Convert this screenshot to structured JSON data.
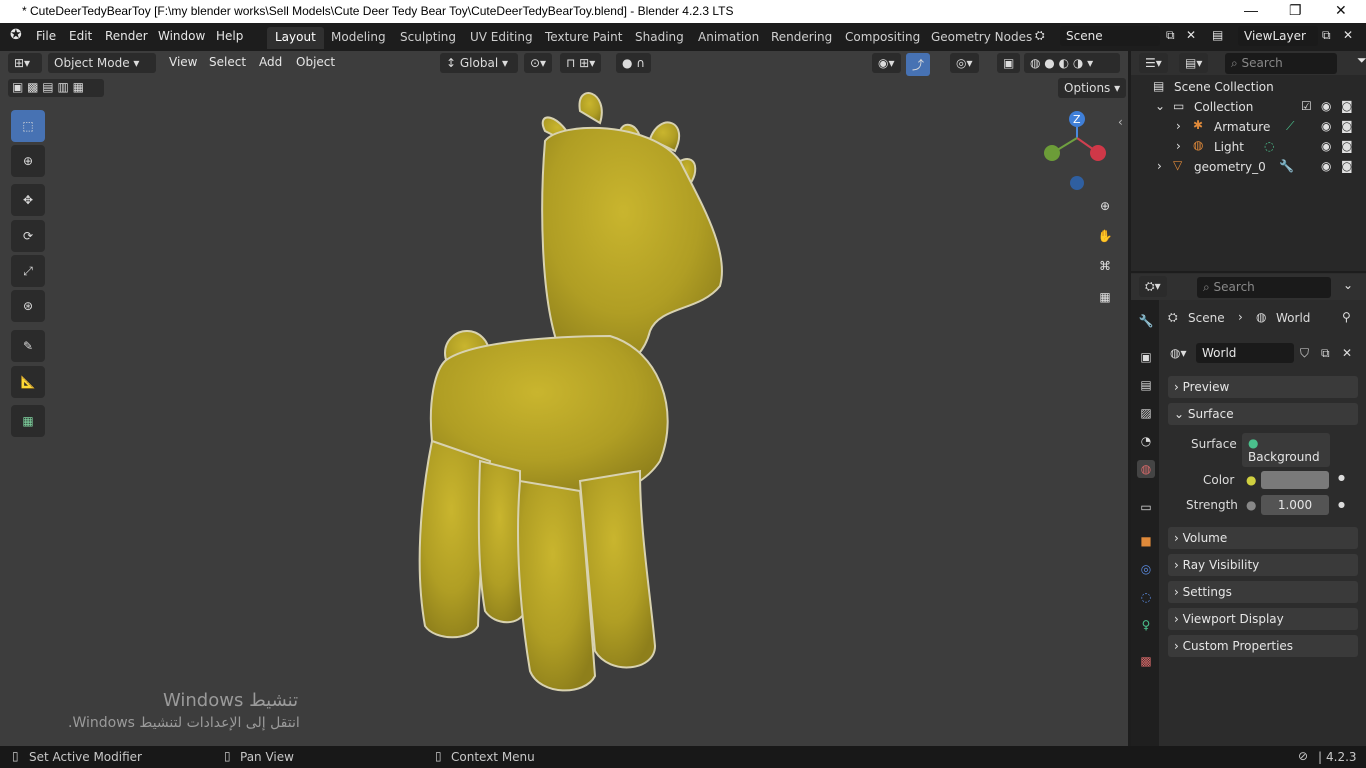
{
  "window": {
    "title": "* CuteDeerTedyBearToy [F:\\my blender works\\Sell Models\\Cute Deer Tedy Bear Toy\\CuteDeerTedyBearToy.blend] - Blender 4.2.3 LTS"
  },
  "menu": [
    "File",
    "Edit",
    "Render",
    "Window",
    "Help"
  ],
  "workspaces": [
    "Layout",
    "Modeling",
    "Sculpting",
    "UV Editing",
    "Texture Paint",
    "Shading",
    "Animation",
    "Rendering",
    "Compositing",
    "Geometry Nodes"
  ],
  "active_workspace": "Layout",
  "scene_name": "Scene",
  "view_layer": "ViewLayer",
  "viewport": {
    "mode": "Object Mode",
    "menus": [
      "View",
      "Select",
      "Add",
      "Object"
    ],
    "orientation": "Global",
    "options_label": "Options",
    "search_placeholder": "Search",
    "model_color": "#b8a425",
    "gizmo": {
      "z": "Z"
    }
  },
  "outliner": {
    "search_placeholder": "Search",
    "scene_collection": "Scene Collection",
    "collection": "Collection",
    "items": [
      {
        "label": "Armature",
        "icon": "armature-icon"
      },
      {
        "label": "Light",
        "icon": "light-icon"
      }
    ],
    "geometry": "geometry_0"
  },
  "properties": {
    "search_placeholder": "Search",
    "breadcrumb": [
      "Scene",
      "World"
    ],
    "world_name": "World",
    "panels": {
      "preview": "Preview",
      "surface": "Surface",
      "volume": "Volume",
      "ray_visibility": "Ray Visibility",
      "settings": "Settings",
      "viewport_display": "Viewport Display",
      "custom_properties": "Custom Properties"
    },
    "surface_label": "Surface",
    "surface_value": "Background",
    "color_label": "Color",
    "strength_label": "Strength",
    "strength_value": "1.000"
  },
  "watermark": {
    "line1": "Windows تنشيط",
    "line2": ".Windows انتقل إلى الإعدادات لتنشيط"
  },
  "status": {
    "left": "Set Active Modifier",
    "middle": "Pan View",
    "right": "Context Menu",
    "version": "4.2.3"
  }
}
